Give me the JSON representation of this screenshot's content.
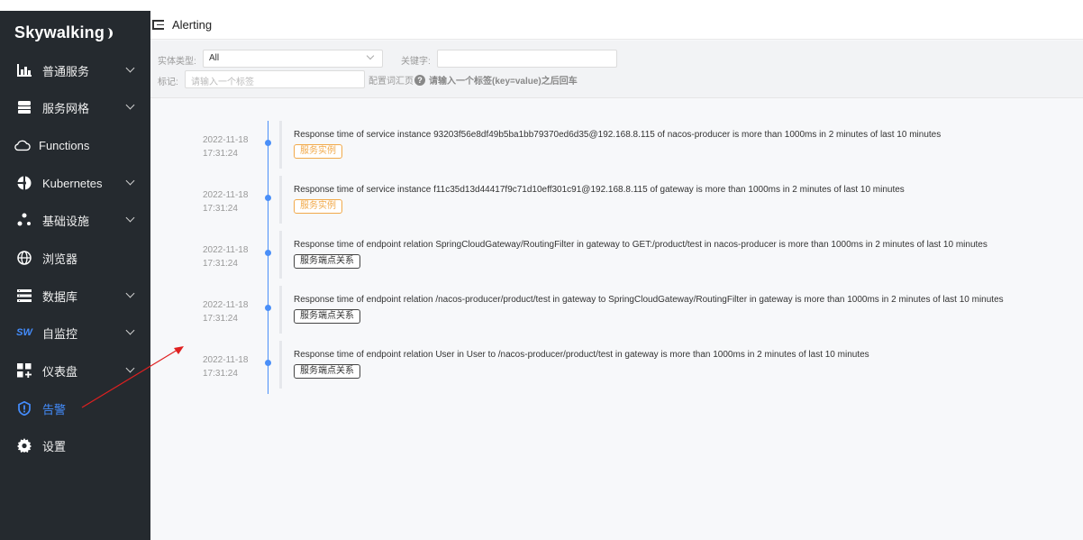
{
  "app": {
    "logo_text": "Skywalking"
  },
  "sidebar": {
    "items": [
      {
        "label": "普通服务",
        "icon": "bar-chart-icon",
        "has_children": true,
        "active": false
      },
      {
        "label": "服务网格",
        "icon": "database-stack-icon",
        "has_children": true,
        "active": false
      },
      {
        "label": "Functions",
        "icon": "cloud-icon",
        "has_children": false,
        "active": false
      },
      {
        "label": "Kubernetes",
        "icon": "kubernetes-icon",
        "has_children": true,
        "active": false
      },
      {
        "label": "基础设施",
        "icon": "nodes-icon",
        "has_children": true,
        "active": false
      },
      {
        "label": "浏览器",
        "icon": "globe-icon",
        "has_children": false,
        "active": false
      },
      {
        "label": "数据库",
        "icon": "list-icon",
        "has_children": true,
        "active": false
      },
      {
        "label": "自监控",
        "icon": "sw-icon",
        "has_children": true,
        "active": false
      },
      {
        "label": "仪表盘",
        "icon": "dashboard-add-icon",
        "has_children": true,
        "active": false
      },
      {
        "label": "告警",
        "icon": "alarm-shield-icon",
        "has_children": false,
        "active": true
      },
      {
        "label": "设置",
        "icon": "gear-icon",
        "has_children": false,
        "active": false
      }
    ],
    "sw_icon_text": "SW"
  },
  "header": {
    "title": "Alerting"
  },
  "filters": {
    "entity_type_label": "实体类型:",
    "entity_type_value": "All",
    "keyword_label": "关键字:",
    "keyword_value": "",
    "tags_label": "标记:",
    "tags_placeholder": "请输入一个标签",
    "config_hint": "配置词汇页",
    "help_glyph": "?",
    "tags_hint": "请输入一个标签(key=value)之后回车"
  },
  "alerts": [
    {
      "date": "2022-11-18",
      "time": "17:31:24",
      "message": "Response time of service instance 93203f56e8df49b5ba1bb79370ed6d35@192.168.8.115 of nacos-producer is more than 1000ms in 2 minutes of last 10 minutes",
      "tag": "服务实例",
      "tag_style": "orange"
    },
    {
      "date": "2022-11-18",
      "time": "17:31:24",
      "message": "Response time of service instance f11c35d13d44417f9c71d10eff301c91@192.168.8.115 of gateway is more than 1000ms in 2 minutes of last 10 minutes",
      "tag": "服务实例",
      "tag_style": "orange"
    },
    {
      "date": "2022-11-18",
      "time": "17:31:24",
      "message": "Response time of endpoint relation SpringCloudGateway/RoutingFilter in gateway to GET:/product/test in nacos-producer is more than 1000ms in 2 minutes of last 10 minutes",
      "tag": "服务端点关系",
      "tag_style": "dark"
    },
    {
      "date": "2022-11-18",
      "time": "17:31:24",
      "message": "Response time of endpoint relation /nacos-producer/product/test in gateway to SpringCloudGateway/RoutingFilter in gateway is more than 1000ms in 2 minutes of last 10 minutes",
      "tag": "服务端点关系",
      "tag_style": "dark"
    },
    {
      "date": "2022-11-18",
      "time": "17:31:24",
      "message": "Response time of endpoint relation User in User to /nacos-producer/product/test in gateway is more than 1000ms in 2 minutes of last 10 minutes",
      "tag": "服务端点关系",
      "tag_style": "dark"
    }
  ],
  "colors": {
    "sidebar_bg": "#252a2f",
    "accent": "#448dfe",
    "timeline": "#4a8ff8",
    "tag_orange": "#f1a94a",
    "annotation_arrow": "#e02020"
  }
}
